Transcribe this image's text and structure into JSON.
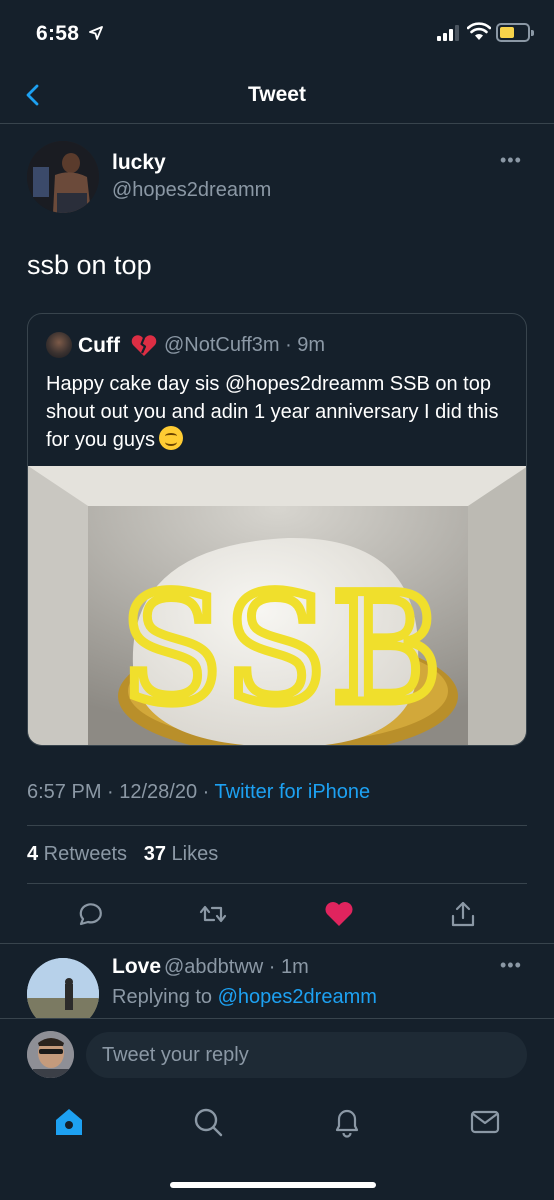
{
  "status_bar": {
    "time": "6:58"
  },
  "header": {
    "title": "Tweet"
  },
  "tweet": {
    "author_name": "lucky",
    "author_handle": "@hopes2dreamm",
    "text": "ssb on top",
    "timestamp": "6:57 PM · 12/28/20 · ",
    "source": "Twitter for iPhone",
    "retweets_count": "4",
    "retweets_label": " Retweets",
    "likes_count": "37",
    "likes_label": " Likes"
  },
  "quoted_tweet": {
    "author_name": "Cuff",
    "author_handle": "@NotCuff3m · 9m",
    "text": "Happy cake day sis @hopes2dreamm SSB on top shout out you and adin 1 year anniversary I did this for you guys",
    "photo_text": "SSB"
  },
  "reply": {
    "author_name": "Love",
    "author_handle": "@abdbtww · 1m",
    "replying_label": "Replying to ",
    "replying_handle": "@hopes2dreamm"
  },
  "composer": {
    "placeholder": "Tweet your reply"
  },
  "icons": {
    "back": "chevron-left-icon",
    "more": "more-icon",
    "reply": "reply-icon",
    "retweet": "retweet-icon",
    "like": "heart-icon",
    "share": "share-icon",
    "home": "home-icon",
    "search": "search-icon",
    "notifications": "bell-icon",
    "messages": "mail-icon"
  },
  "colors": {
    "background": "#15202b",
    "accent": "#1da1f2",
    "like": "#e0245e",
    "muted": "#8b98a5"
  }
}
